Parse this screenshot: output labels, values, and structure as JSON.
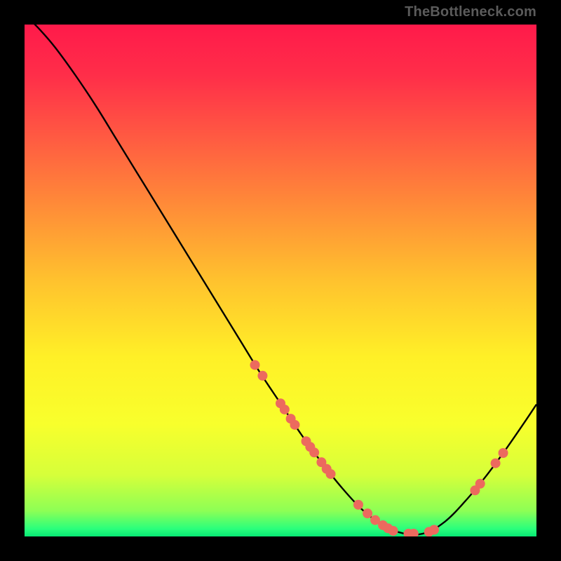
{
  "attribution": "TheBottleneck.com",
  "gradient": {
    "stops": [
      {
        "offset": 0.0,
        "color": "#ff1a4a"
      },
      {
        "offset": 0.1,
        "color": "#ff2e49"
      },
      {
        "offset": 0.22,
        "color": "#ff5a42"
      },
      {
        "offset": 0.35,
        "color": "#ff8a38"
      },
      {
        "offset": 0.5,
        "color": "#ffc22e"
      },
      {
        "offset": 0.65,
        "color": "#fff027"
      },
      {
        "offset": 0.78,
        "color": "#f8ff2c"
      },
      {
        "offset": 0.88,
        "color": "#d6ff3a"
      },
      {
        "offset": 0.95,
        "color": "#8dff55"
      },
      {
        "offset": 0.985,
        "color": "#2aff7c"
      },
      {
        "offset": 1.0,
        "color": "#07e874"
      }
    ]
  },
  "chart_data": {
    "type": "line",
    "title": "",
    "xlabel": "",
    "ylabel": "",
    "xlim": [
      0,
      100
    ],
    "ylim": [
      0,
      100
    ],
    "series": [
      {
        "name": "curve",
        "x": [
          0,
          3,
          6,
          10,
          14,
          18,
          22,
          26,
          30,
          34,
          38,
          42,
          46,
          50,
          54,
          58,
          62,
          66,
          70,
          74,
          78,
          82,
          86,
          90,
          94,
          98,
          100
        ],
        "y": [
          102,
          99,
          95.5,
          90,
          84,
          77.5,
          71,
          64.5,
          58,
          51.5,
          45,
          38.5,
          32,
          26,
          20,
          14.5,
          9.5,
          5.2,
          2.2,
          0.6,
          0.6,
          2.8,
          6.8,
          11.6,
          17,
          22.8,
          25.8
        ]
      }
    ],
    "scatter": {
      "name": "points",
      "color": "#ec6a5e",
      "radius": 7,
      "points": [
        {
          "x": 45,
          "y": 33.5
        },
        {
          "x": 46.5,
          "y": 31.4
        },
        {
          "x": 50,
          "y": 26.0
        },
        {
          "x": 50.8,
          "y": 24.8
        },
        {
          "x": 52,
          "y": 23.0
        },
        {
          "x": 52.8,
          "y": 21.8
        },
        {
          "x": 55,
          "y": 18.6
        },
        {
          "x": 55.8,
          "y": 17.5
        },
        {
          "x": 56.6,
          "y": 16.4
        },
        {
          "x": 58,
          "y": 14.5
        },
        {
          "x": 59,
          "y": 13.2
        },
        {
          "x": 59.8,
          "y": 12.2
        },
        {
          "x": 65.2,
          "y": 6.2
        },
        {
          "x": 67,
          "y": 4.5
        },
        {
          "x": 68.5,
          "y": 3.2
        },
        {
          "x": 70,
          "y": 2.2
        },
        {
          "x": 71,
          "y": 1.6
        },
        {
          "x": 72,
          "y": 1.1
        },
        {
          "x": 75,
          "y": 0.55
        },
        {
          "x": 76,
          "y": 0.55
        },
        {
          "x": 79,
          "y": 0.9
        },
        {
          "x": 80,
          "y": 1.3
        },
        {
          "x": 88,
          "y": 9.0
        },
        {
          "x": 89,
          "y": 10.3
        },
        {
          "x": 92,
          "y": 14.3
        },
        {
          "x": 93.5,
          "y": 16.3
        }
      ]
    }
  }
}
